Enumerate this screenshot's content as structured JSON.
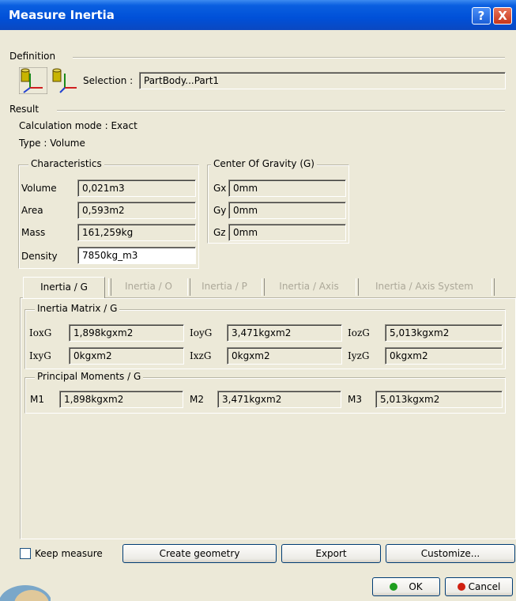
{
  "window": {
    "title": "Measure Inertia",
    "help_glyph": "?",
    "close_glyph": "X"
  },
  "definition": {
    "group_label": "Definition",
    "selection_label": "Selection :",
    "selection_value": "PartBody...Part1"
  },
  "result": {
    "group_label": "Result",
    "calc_mode": "Calculation mode : Exact",
    "type": "Type : Volume"
  },
  "characteristics": {
    "group_label": "Characteristics",
    "rows": [
      {
        "label": "Volume",
        "value": "0,021m3"
      },
      {
        "label": "Area",
        "value": "0,593m2"
      },
      {
        "label": "Mass",
        "value": "161,259kg"
      },
      {
        "label": "Density",
        "value": "7850kg_m3"
      }
    ]
  },
  "cog": {
    "group_label": "Center Of Gravity (G)",
    "rows": [
      {
        "label": "Gx",
        "value": "0mm"
      },
      {
        "label": "Gy",
        "value": "0mm"
      },
      {
        "label": "Gz",
        "value": "0mm"
      }
    ]
  },
  "tabs": [
    "Inertia / G",
    "Inertia / O",
    "Inertia / P",
    "Inertia / Axis",
    "Inertia / Axis System"
  ],
  "inertia_matrix": {
    "group_label": "Inertia Matrix / G",
    "row1": [
      {
        "label": "IoxG",
        "value": "1,898kgxm2"
      },
      {
        "label": "IoyG",
        "value": "3,471kgxm2"
      },
      {
        "label": "IozG",
        "value": "5,013kgxm2"
      }
    ],
    "row2": [
      {
        "label": "IxyG",
        "value": "0kgxm2"
      },
      {
        "label": "IxzG",
        "value": "0kgxm2"
      },
      {
        "label": "IyzG",
        "value": "0kgxm2"
      }
    ]
  },
  "principal": {
    "group_label": "Principal Moments / G",
    "row": [
      {
        "label": "M1",
        "value": "1,898kgxm2"
      },
      {
        "label": "M2",
        "value": "3,471kgxm2"
      },
      {
        "label": "M3",
        "value": "5,013kgxm2"
      }
    ]
  },
  "bottom": {
    "keep_measure": "Keep measure",
    "create_geometry": "Create geometry",
    "export": "Export",
    "customize": "Customize...",
    "ok": "OK",
    "cancel": "Cancel"
  },
  "colors": {
    "title_bar": "#0050d8",
    "ok_green": "#1e9e1e",
    "cancel_red": "#d02010"
  }
}
